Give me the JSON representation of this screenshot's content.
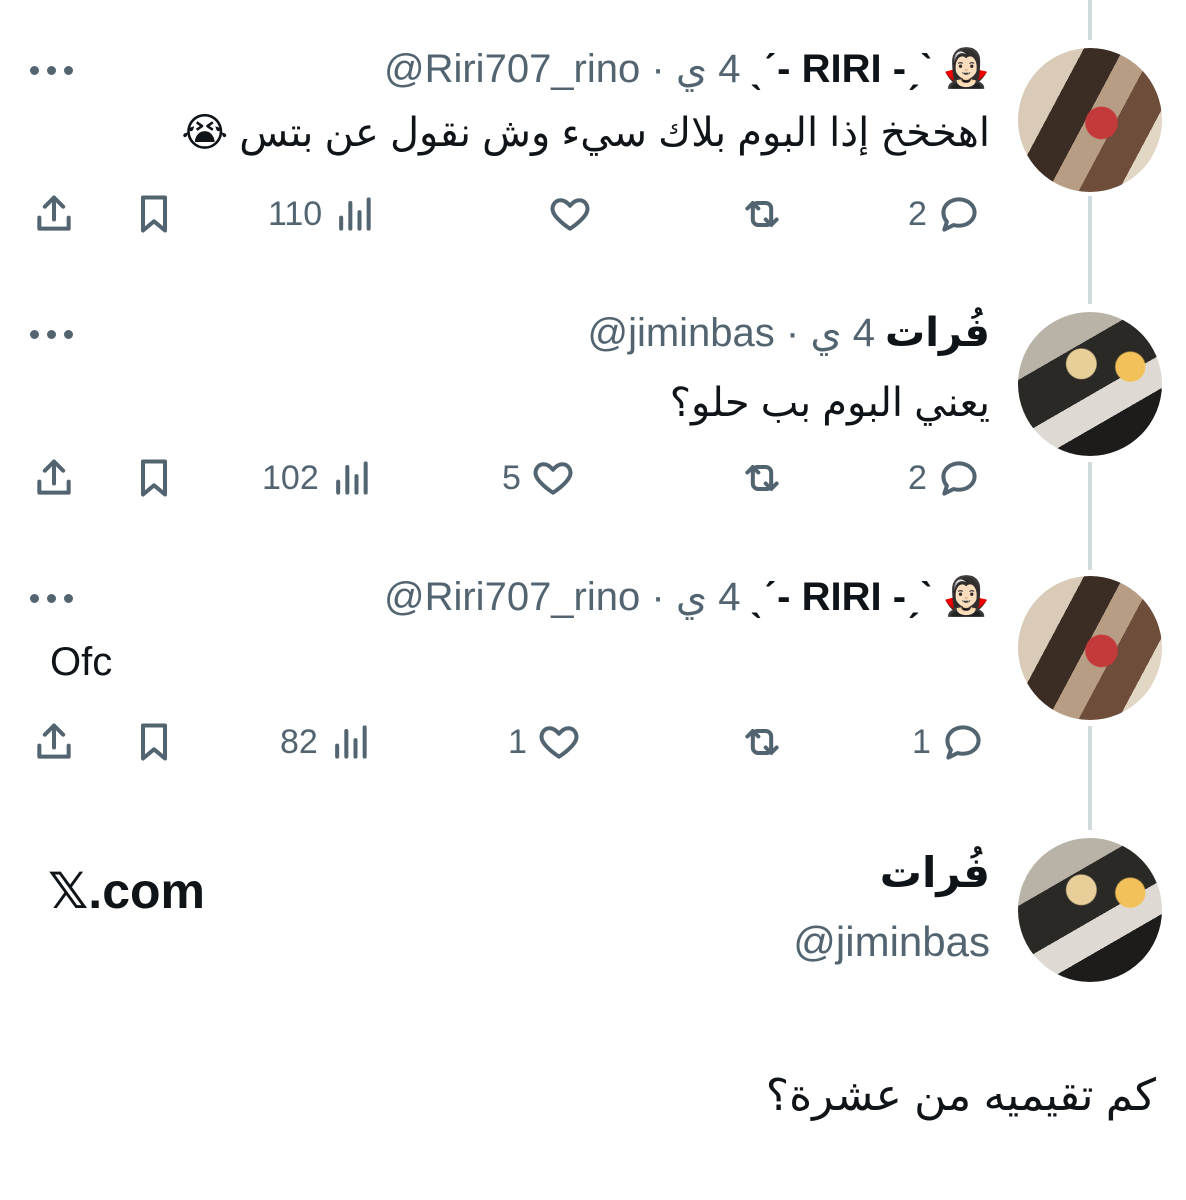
{
  "tweets": [
    {
      "author": "RIRI",
      "name_decor_left": "-ˏˋ",
      "name_decor_right": "ˎˊ-",
      "emoji": "🧛🏻‍♀️",
      "handle": "@Riri707_rino",
      "time": "4 ي",
      "text": "اهخخخ إذا البوم بلاك سيء وش نقول عن بتس 😭",
      "replies": "2",
      "reposts": "",
      "likes": "",
      "views": "110"
    },
    {
      "author": "فُرات",
      "handle": "@jiminbas",
      "time": "4 ي",
      "text": "يعني البوم بب حلو؟",
      "replies": "2",
      "reposts": "",
      "likes": "5",
      "views": "102"
    },
    {
      "author": "RIRI",
      "name_decor_left": "-ˏˋ",
      "name_decor_right": "ˎˊ-",
      "emoji": "🧛🏻‍♀️",
      "handle": "@Riri707_rino",
      "time": "4 ي",
      "text": "Ofc",
      "replies": "1",
      "reposts": "",
      "likes": "1",
      "views": "82"
    }
  ],
  "card": {
    "name": "فُرات",
    "handle": "@jiminbas",
    "logo_x": "𝕏",
    "logo_domain": ".com"
  },
  "question": "كم تقيميه من عشرة؟",
  "icons": [
    "share-icon",
    "bookmark-icon",
    "views-icon",
    "like-icon",
    "repost-icon",
    "reply-icon",
    "more-icon"
  ],
  "colors": {
    "text": "#0f1419",
    "secondary": "#536471",
    "thread_line": "#cfd9de",
    "background": "#ffffff"
  }
}
